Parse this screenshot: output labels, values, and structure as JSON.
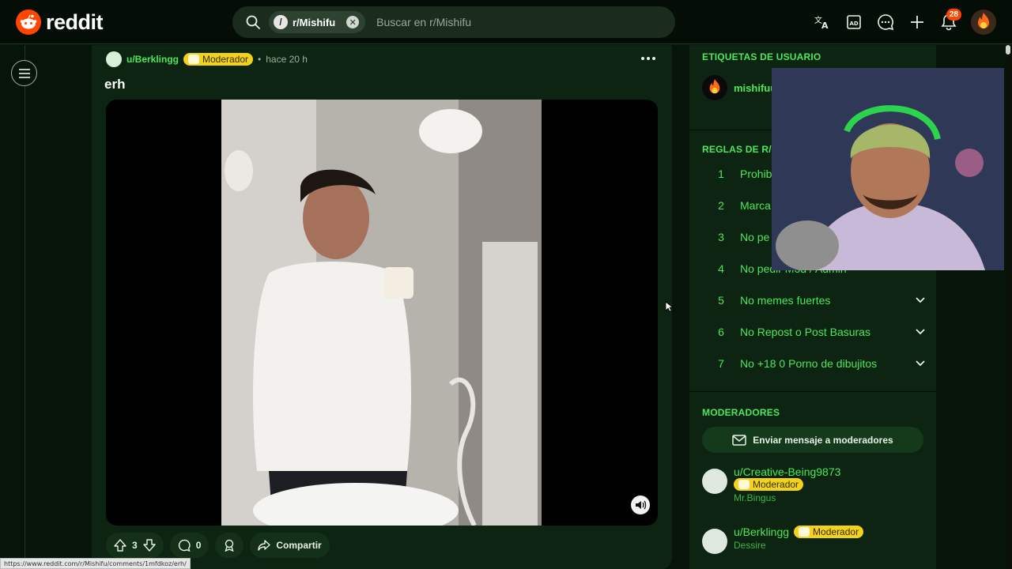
{
  "header": {
    "logo_text": "reddit",
    "search": {
      "community_chip": "r/Mishifu",
      "placeholder": "Buscar en r/Mishifu"
    },
    "icons": [
      "translate-icon",
      "advertise-icon",
      "chat-icon",
      "create-post-icon",
      "notifications-icon",
      "user-avatar"
    ],
    "notifications_count": "28"
  },
  "post": {
    "author": "u/Berklingg",
    "flair_label": "Moderador",
    "separator": "•",
    "time": "hace 20 h",
    "title": "erh",
    "actions": {
      "votes": "3",
      "comments": "0",
      "share_label": "Compartir"
    }
  },
  "sidebar": {
    "user_flair_heading": "ETIQUETAS DE USUARIO",
    "user_flair_name": "mishifuu",
    "rules_heading": "REGLAS DE R/M",
    "rules": [
      {
        "num": "1",
        "text": "Prohib"
      },
      {
        "num": "2",
        "text": "Marca"
      },
      {
        "num": "3",
        "text": "No pe"
      },
      {
        "num": "4",
        "text": "No pedir Mod / Admin"
      },
      {
        "num": "5",
        "text": "No memes fuertes"
      },
      {
        "num": "6",
        "text": "No Repost o Post Basuras"
      },
      {
        "num": "7",
        "text": "No +18 0 Porno de dibujitos"
      }
    ],
    "moderators_heading": "MODERADORES",
    "message_button": "Enviar mensaje a moderadores",
    "moderators": [
      {
        "name": "u/Creative-Being9873",
        "flair": "Moderador",
        "sub": "Mr.Bingus"
      },
      {
        "name": "u/Berklingg",
        "flair": "Moderador",
        "sub": "Dessire"
      }
    ]
  },
  "status_bar_url": "https://www.reddit.com/r/Mishifu/comments/1mfdkoz/erh/",
  "colors": {
    "accent_green": "#4be85a",
    "background": "#06140a",
    "card": "#0c2411",
    "moderator_badge": "#f2d21b",
    "reddit_orange": "#ff4500"
  }
}
